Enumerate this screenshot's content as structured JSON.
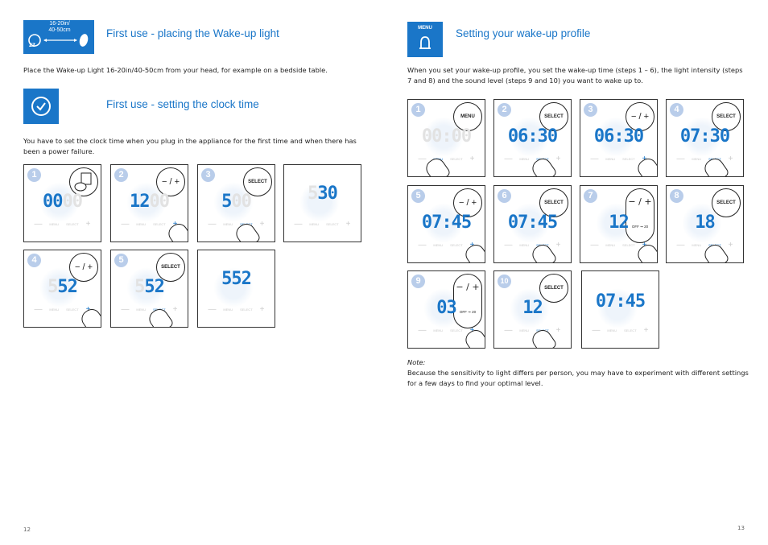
{
  "left_page": {
    "section1": {
      "icon": "distance-icon",
      "icon_label": "16-20in/ 40-50cm",
      "title": "First use - placing the Wake-up light",
      "text": "Place the Wake-up Light 16-20in/40-50cm from your head, for example on a bedside table."
    },
    "section2": {
      "icon": "clock-check-icon",
      "title": "First use - setting the clock time",
      "text": "You have to set the clock time when you plug in the appliance for the first time and when there has been a power failure."
    },
    "steps": [
      {
        "num": "1",
        "button": "plug-icon",
        "digits_lit": "00",
        "digits_dim": "00",
        "active": ""
      },
      {
        "num": "2",
        "button": "− / +",
        "digits_lit": "12",
        "digits_dim": "00",
        "active": "+"
      },
      {
        "num": "3",
        "button": "SELECT",
        "digits_lit": "5",
        "digits_dim": "00",
        "active": "SELECT"
      },
      {
        "num": "",
        "button": "",
        "digits_dim": "5",
        "digits_lit": "30",
        "active": ""
      },
      {
        "num": "4",
        "button": "− / +",
        "digits_dim": "5",
        "digits_lit": "52",
        "active": "+"
      },
      {
        "num": "5",
        "button": "SELECT",
        "digits_dim": "5",
        "digits_lit": "52",
        "active": "SELECT"
      },
      {
        "num": "",
        "button": "",
        "digits_dim": "",
        "digits_lit": "552",
        "active": ""
      }
    ],
    "page_number": "12"
  },
  "right_page": {
    "section": {
      "icon_label": "MENU",
      "icon": "bell-icon",
      "title": "Setting your wake-up profile",
      "text": "When you set your wake-up profile, you set the wake-up time (steps 1 – 6), the light intensity (steps 7 and 8) and the sound level (steps 9 and 10) you want to wake up to."
    },
    "steps": [
      {
        "num": "1",
        "button": "MENU",
        "display": "00:00",
        "active": "MENU"
      },
      {
        "num": "2",
        "button": "SELECT",
        "display": "06:30",
        "active": "SELECT"
      },
      {
        "num": "3",
        "button": "− / +",
        "display": "06:30",
        "active": "+"
      },
      {
        "num": "4",
        "button": "SELECT",
        "display": "07:30",
        "active": "SELECT"
      },
      {
        "num": "5",
        "button": "− / +",
        "display": "07:45",
        "active": "+"
      },
      {
        "num": "6",
        "button": "SELECT",
        "display": "07:45",
        "active": "SELECT"
      },
      {
        "num": "7",
        "button": "− / +",
        "display": "12",
        "range_from": "OFF",
        "range_to": "20",
        "active": "+"
      },
      {
        "num": "8",
        "button": "SELECT",
        "display": "18",
        "active": "SELECT"
      },
      {
        "num": "9",
        "button": "− / +",
        "display": "03",
        "range_from": "OFF",
        "range_to": "20",
        "active": "+"
      },
      {
        "num": "10",
        "button": "SELECT",
        "display": "12",
        "active": "SELECT"
      },
      {
        "num": "",
        "button": "",
        "display": "07:45",
        "active": ""
      }
    ],
    "note_label": "Note:",
    "note_text": "Because the sensitivity to light differs per person, you may have to experiment with different settings for a few days to find your optimal level.",
    "page_number": "13"
  },
  "device_labels": {
    "minus": "—",
    "menu": "MENU",
    "select": "SELECT",
    "plus": "+"
  },
  "colors": {
    "accent": "#1a76c8",
    "step_badge": "#b9cdea"
  }
}
